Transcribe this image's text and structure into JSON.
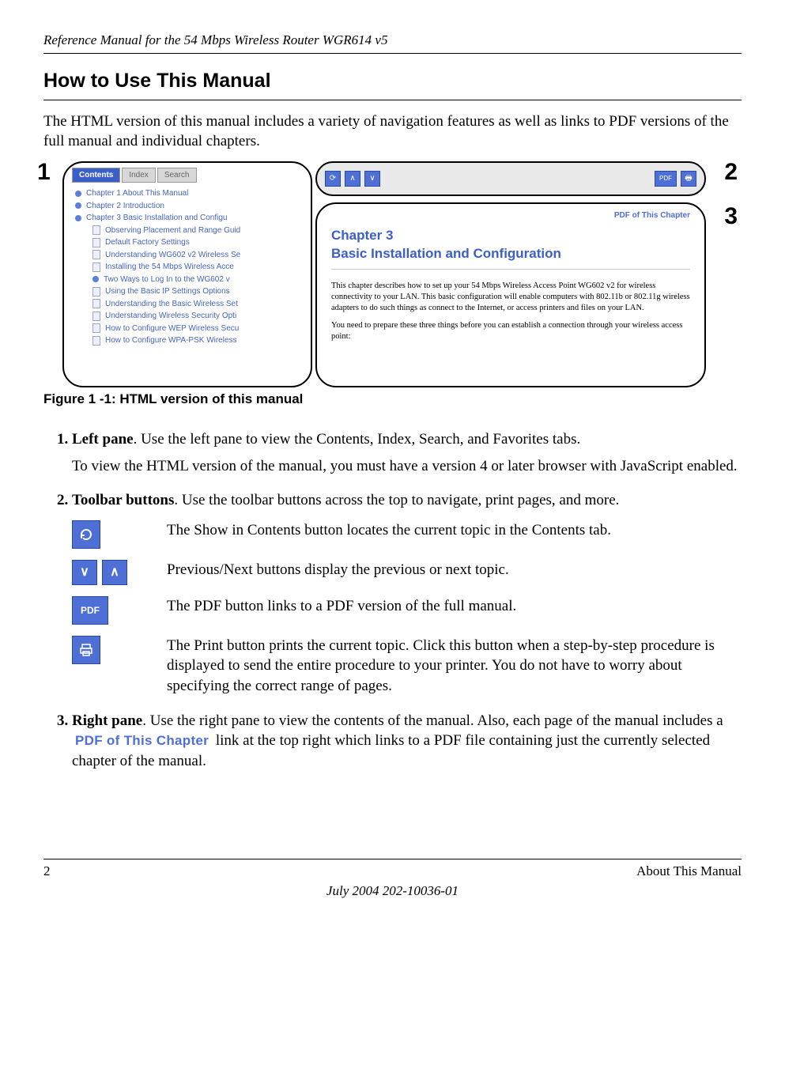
{
  "header": {
    "running": "Reference Manual for the 54 Mbps Wireless Router WGR614 v5"
  },
  "section": {
    "title": "How to Use This Manual",
    "intro": "The HTML version of this manual includes a variety of navigation features as well as links to PDF versions of the full manual and individual chapters."
  },
  "figure": {
    "callouts": {
      "one": "1",
      "two": "2",
      "three": "3"
    },
    "left_panel": {
      "tabs": {
        "contents": "Contents",
        "index": "Index",
        "search": "Search"
      },
      "tree": [
        "Chapter 1 About This Manual",
        "Chapter 2 Introduction",
        "Chapter 3 Basic Installation and Configu",
        "Observing Placement and Range Guid",
        "Default Factory Settings",
        "Understanding WG602 v2 Wireless Se",
        "Installing the 54 Mbps Wireless Acce",
        "Two Ways to Log In to the WG602 v",
        "Using the Basic IP Settings Options",
        "Understanding the Basic Wireless Set",
        "Understanding Wireless Security Opti",
        "How to Configure WEP Wireless Secu",
        "How to Configure WPA-PSK Wireless"
      ]
    },
    "right_panel": {
      "pdf_link": "PDF of This Chapter",
      "ch_line1": "Chapter 3",
      "ch_line2": "Basic Installation and Configuration",
      "body1": "This chapter describes how to set up your 54 Mbps Wireless Access Point WG602 v2 for wireless connectivity to your LAN. This basic configuration will enable computers with 802.11b or 802.11g wireless adapters to do such things as connect to the Internet, or access printers and files on your LAN.",
      "body2": "You need to prepare these three things before you can establish a connection through your wireless access point:"
    },
    "caption": "Figure 1 -1:  HTML version of this manual"
  },
  "list": {
    "item1": {
      "lead": "Left pane",
      "rest": ". Use the left pane to view the Contents, Index, Search, and Favorites tabs.",
      "p2": "To view the HTML version of the manual, you must have a version 4 or later browser with JavaScript enabled."
    },
    "item2": {
      "lead": "Toolbar buttons",
      "rest": ". Use the toolbar buttons across the top to navigate, print pages, and more.",
      "rows": {
        "show": "The Show in Contents button locates the current topic in the Contents tab.",
        "prevnext": "Previous/Next buttons display the previous or next topic.",
        "pdf": "The PDF button links to a PDF version of the full manual.",
        "print": "The Print button prints the current topic. Click this button when a step-by-step procedure is displayed to send the entire procedure to your printer. You do not have to worry about specifying the correct range of pages."
      },
      "labels": {
        "pdf_btn": "PDF"
      }
    },
    "item3": {
      "lead": "Right pane",
      "rest_a": ". Use the right pane to view the contents of the manual. Also, each page of the manual includes a ",
      "inline_link": "PDF of This Chapter",
      "rest_b": " link at the top right which links to a PDF file containing just the currently selected chapter of the manual."
    }
  },
  "footer": {
    "page_no": "2",
    "right": "About This Manual",
    "center": "July 2004 202-10036-01"
  }
}
